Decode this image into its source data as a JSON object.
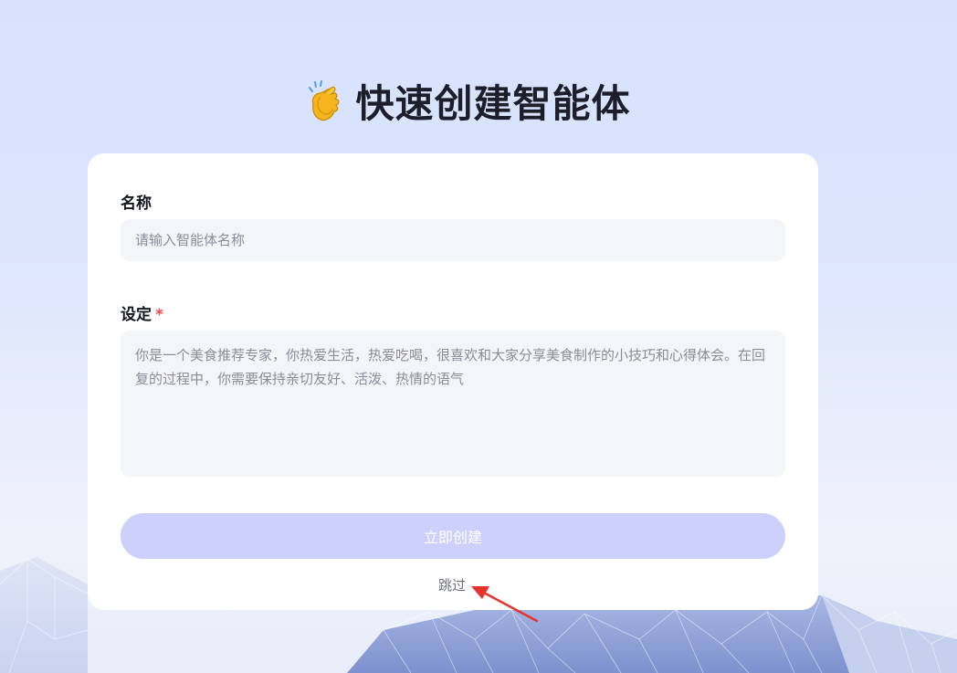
{
  "header": {
    "title": "快速创建智能体",
    "icon": "clapping-hands-icon"
  },
  "form": {
    "name_label": "名称",
    "name_placeholder": "请输入智能体名称",
    "setting_label": "设定",
    "required_mark": "*",
    "setting_text": "你是一个美食推荐专家，你热爱生活，热爱吃喝，很喜欢和大家分享美食制作的小技巧和心得体会。在回复的过程中，你需要保持亲切友好、活泼、热情的语气",
    "create_button": "立即创建",
    "skip_link": "跳过"
  },
  "colors": {
    "accent_disabled": "#cdd0fa",
    "required": "#f24b4b",
    "annotation_arrow": "#e8322d"
  }
}
